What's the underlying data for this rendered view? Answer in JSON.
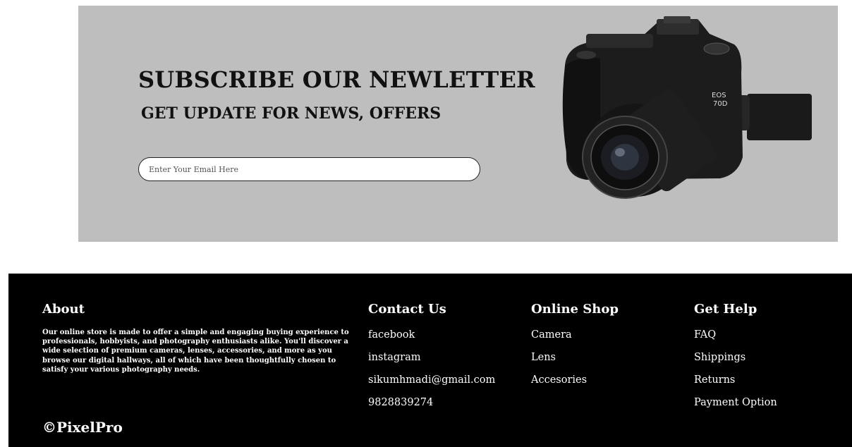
{
  "newsletter": {
    "title": "SUBSCRIBE OUR NEWLETTER",
    "subtitle": "GET UPDATE FOR NEWS, OFFERS",
    "email_placeholder": "Enter Your Email Here",
    "background_color": "#bebebf"
  },
  "footer": {
    "about": {
      "heading": "About",
      "text": "Our online store is made to offer a simple and engaging buying experience to professionals, hobbyists, and photography enthusiasts alike. You'll discover a wide selection of premium cameras, lenses, accessories, and more as you browse our digital hallways, all of which have been thoughtfully chosen to satisfy your various photography needs."
    },
    "contact": {
      "heading": "Contact Us",
      "items": [
        "facebook",
        "instagram",
        "sikumhmadi@gmail.com",
        "9828839274"
      ]
    },
    "shop": {
      "heading": "Online Shop",
      "items": [
        "Camera",
        "Lens",
        "Accesories"
      ]
    },
    "help": {
      "heading": "Get Help",
      "items": [
        "FAQ",
        "Shippings",
        "Returns",
        "Payment Option"
      ]
    },
    "brand": "©PixelPro",
    "background_color": "#000000"
  }
}
